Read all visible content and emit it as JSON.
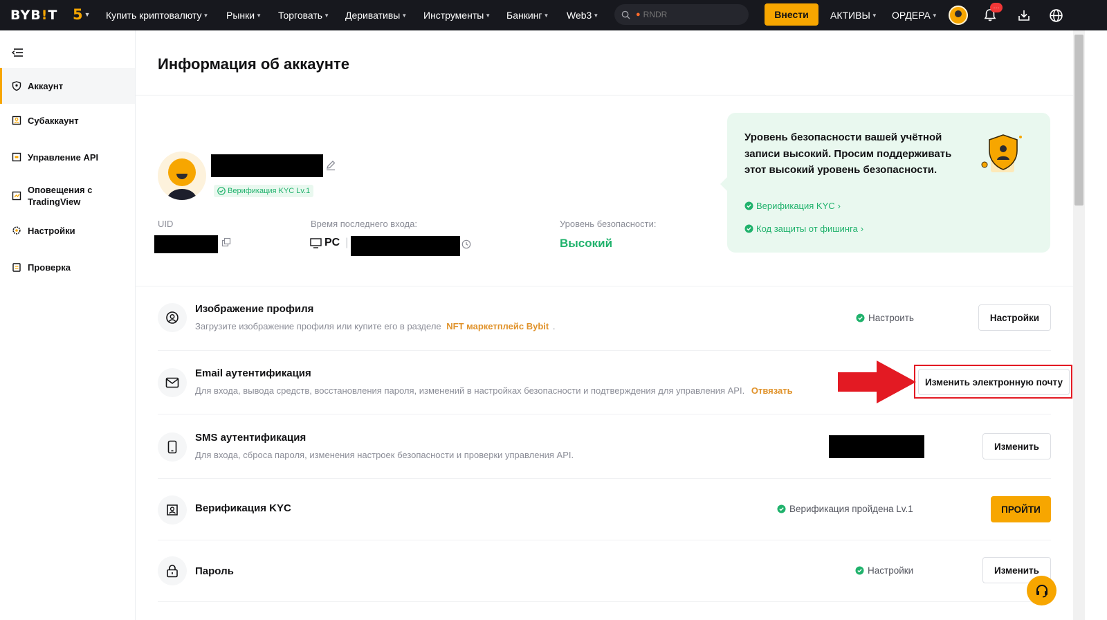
{
  "topnav": {
    "logo": "BYB",
    "logo_accent": "!",
    "logo_end": "T",
    "five_label": "5",
    "items": [
      {
        "label": "Купить криптовалюту"
      },
      {
        "label": "Рынки"
      },
      {
        "label": "Торговать"
      },
      {
        "label": "Деривативы"
      },
      {
        "label": "Инструменты"
      },
      {
        "label": "Банкинг"
      },
      {
        "label": "Web3"
      }
    ],
    "search_placeholder": "RNDR",
    "deposit_label": "Внести",
    "assets_label": "АКТИВЫ",
    "orders_label": "ОРДЕРА",
    "notif_badge": "···"
  },
  "sidebar": {
    "items": [
      {
        "label": "Аккаунт",
        "icon": "shield-icon"
      },
      {
        "label": "Субаккаунт",
        "icon": "user-square-icon"
      },
      {
        "label": "Управление API",
        "icon": "api-icon"
      },
      {
        "label": "Оповещения с TradingView",
        "icon": "alert-icon"
      },
      {
        "label": "Настройки",
        "icon": "gear-icon"
      },
      {
        "label": "Проверка",
        "icon": "clipboard-icon"
      }
    ]
  },
  "account": {
    "title": "Информация об аккаунте",
    "kyc_badge": "Верификация KYC Lv.1",
    "uid_label": "UID",
    "last_login_label": "Время последнего входа:",
    "device": "PC",
    "security_level_label": "Уровень безопасности:",
    "security_level_value": "Высокий"
  },
  "security_card": {
    "message": "Уровень безопасности вашей учётной записи высокий. Просим поддерживать этот высокий уровень безопасности.",
    "link_kyc": "Верификация KYC",
    "link_phishing": "Код защиты от фишинга"
  },
  "rows": {
    "profile_image": {
      "title": "Изображение профиля",
      "desc": "Загрузите изображение профиля или купите его в разделе",
      "desc_link": "NFT маркетплейс Bybit",
      "desc_end": ".",
      "status": "Настроить",
      "button": "Настройки"
    },
    "email": {
      "title": "Email аутентификация",
      "desc": "Для входа, вывода средств, восстановления пароля, изменений в настройках безопасности и подтверждения для управления API.",
      "desc_link": "Отвязать",
      "button": "Изменить электронную почту"
    },
    "sms": {
      "title": "SMS аутентификация",
      "desc": "Для входа, сброса пароля, изменения настроек безопасности и проверки управления API.",
      "button": "Изменить"
    },
    "kyc": {
      "title": "Верификация KYC",
      "status": "Верификация пройдена Lv.1",
      "button": "ПРОЙТИ"
    },
    "password": {
      "title": "Пароль",
      "status": "Настройки",
      "button": "Изменить"
    }
  },
  "colors": {
    "brand": "#f7a600",
    "success": "#20b26c",
    "annotation": "#e31a23"
  }
}
